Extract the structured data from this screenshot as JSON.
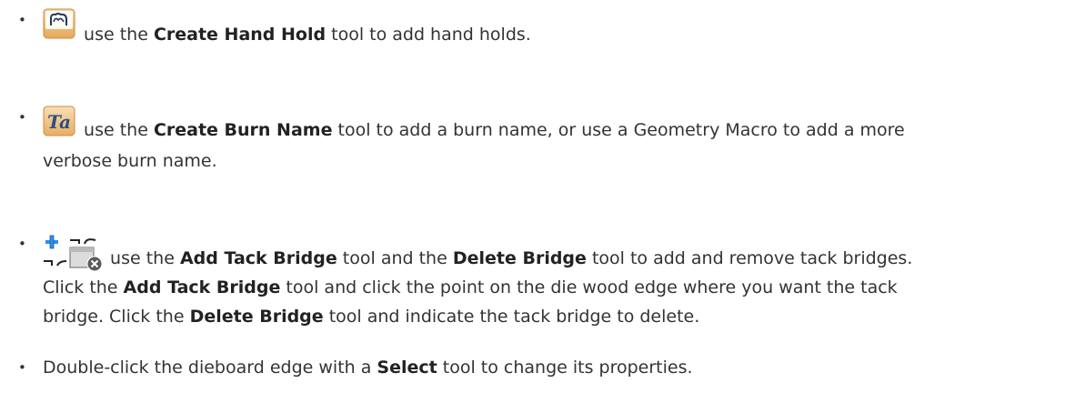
{
  "items": [
    {
      "icon": "hand-hold-icon",
      "segments": [
        {
          "text": " use the ",
          "bold": false
        },
        {
          "text": "Create Hand Hold",
          "bold": true
        },
        {
          "text": " tool to add hand holds.",
          "bold": false
        }
      ]
    },
    {
      "icon": "burn-name-icon",
      "icon_text": "Ta",
      "segments": [
        {
          "text": " use the ",
          "bold": false
        },
        {
          "text": "Create Burn Name",
          "bold": true
        },
        {
          "text": " tool to add a burn name, or use a Geometry Macro to add a more",
          "bold": false
        }
      ],
      "line2": "verbose burn name."
    },
    {
      "icons": [
        "add-tack-bridge-icon",
        "delete-bridge-icon"
      ],
      "segments": [
        {
          "text": " use the ",
          "bold": false
        },
        {
          "text": "Add Tack Bridge",
          "bold": true
        },
        {
          "text": " tool and the ",
          "bold": false
        },
        {
          "text": "Delete Bridge",
          "bold": true
        },
        {
          "text": " tool to add and remove tack bridges.",
          "bold": false
        }
      ],
      "line2_segments": [
        {
          "text": "Click the ",
          "bold": false
        },
        {
          "text": "Add Tack Bridge",
          "bold": true
        },
        {
          "text": " tool and click the point on the die wood edge where you want the tack",
          "bold": false
        }
      ],
      "line3_segments": [
        {
          "text": "bridge. Click the ",
          "bold": false
        },
        {
          "text": "Delete Bridge",
          "bold": true
        },
        {
          "text": " tool and indicate the tack bridge to delete.",
          "bold": false
        }
      ]
    },
    {
      "segments": [
        {
          "text": "Double-click the dieboard edge with a ",
          "bold": false
        },
        {
          "text": "Select",
          "bold": true
        },
        {
          "text": " tool to change its properties.",
          "bold": false
        }
      ]
    }
  ],
  "bullet": "•"
}
